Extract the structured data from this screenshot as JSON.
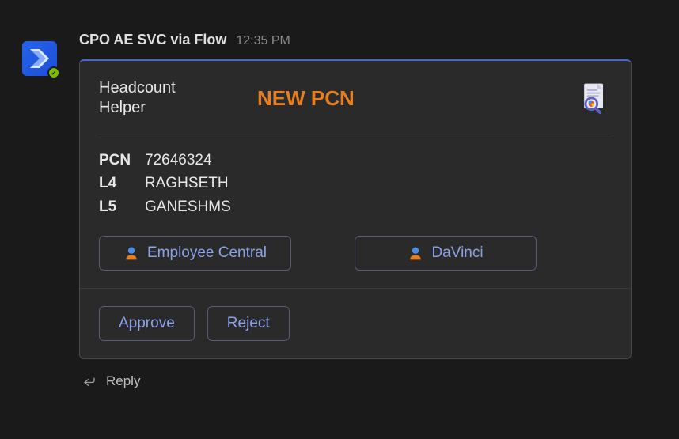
{
  "sender": "CPO AE SVC via Flow",
  "timestamp": "12:35 PM",
  "card": {
    "app_name": "Headcount Helper",
    "heading": "NEW PCN",
    "fields": [
      {
        "label": "PCN",
        "value": "72646324"
      },
      {
        "label": "L4",
        "value": "RAGHSETH"
      },
      {
        "label": "L5",
        "value": "GANESHMS"
      }
    ],
    "link_buttons": [
      {
        "label": "Employee Central"
      },
      {
        "label": "DaVinci"
      }
    ],
    "actions": [
      {
        "label": "Approve"
      },
      {
        "label": "Reject"
      }
    ]
  },
  "reply_label": "Reply"
}
